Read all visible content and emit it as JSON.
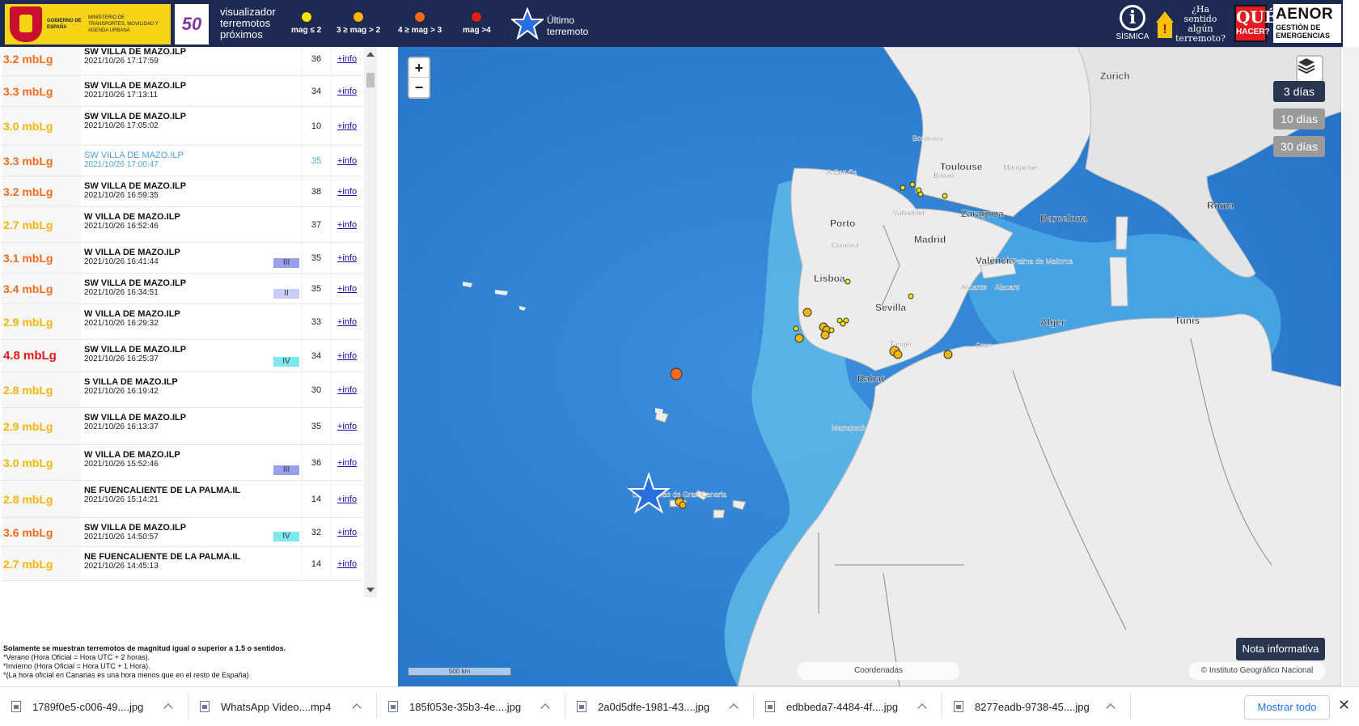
{
  "header": {
    "gov_line1": "GOBIERNO DE ESPAÑA",
    "gov_line2": "MINISTERIO DE TRANSPORTES, MOVILIDAD Y AGENDA URBANA",
    "logo50_number": "50",
    "app_title": "visualizador terremotos próximos",
    "legend": [
      {
        "label": "mag ≤ 2",
        "color": "#f5e10c"
      },
      {
        "label": "3 ≥ mag > 2",
        "color": "#f5b50c"
      },
      {
        "label": "4 ≥ mag > 3",
        "color": "#f26b1d"
      },
      {
        "label": "mag >4",
        "color": "#d91e1e"
      }
    ],
    "last_quake_label": "Último terremoto",
    "sismica_label": "SÍSMICA",
    "sentido_label": "¿Ha sentido algún terremoto?",
    "quehacer_q": "QUÉ",
    "quehacer_h": "HACER?",
    "aenor_name": "AENOR",
    "aenor_sub": "GESTIÓN DE EMERGENCIAS"
  },
  "earthquakes": [
    {
      "mag": "3.2 mbLg",
      "color": "#f26b1d",
      "loc": "SW VILLA DE MAZO.ILP",
      "date": "2021/10/26 17:17:59",
      "depth": "36",
      "intensity": "",
      "info": "+info",
      "highlight": false
    },
    {
      "mag": "3.3 mbLg",
      "color": "#f26b1d",
      "loc": "SW VILLA DE MAZO.ILP",
      "date": "2021/10/26 17:13:11",
      "depth": "34",
      "intensity": "",
      "info": "+info",
      "highlight": false
    },
    {
      "mag": "3.0 mbLg",
      "color": "#f5b50c",
      "loc": "SW VILLA DE MAZO.ILP",
      "date": "2021/10/26 17:05:02",
      "depth": "10",
      "intensity": "",
      "info": "+info",
      "highlight": false
    },
    {
      "mag": "3.3 mbLg",
      "color": "#f26b1d",
      "loc": "SW VILLA DE MAZO.ILP",
      "date": "2021/10/26 17:00:47",
      "depth": "35",
      "intensity": "",
      "info": "+info",
      "highlight": true
    },
    {
      "mag": "3.2 mbLg",
      "color": "#f26b1d",
      "loc": "SW VILLA DE MAZO.ILP",
      "date": "2021/10/26 16:59:35",
      "depth": "38",
      "intensity": "",
      "info": "+info",
      "highlight": false
    },
    {
      "mag": "2.7 mbLg",
      "color": "#f5b50c",
      "loc": "W VILLA DE MAZO.ILP",
      "date": "2021/10/26 16:52:46",
      "depth": "37",
      "intensity": "",
      "info": "+info",
      "highlight": false
    },
    {
      "mag": "3.1 mbLg",
      "color": "#f26b1d",
      "loc": "W VILLA DE MAZO.ILP",
      "date": "2021/10/26 16:41:44",
      "depth": "35",
      "intensity": "III",
      "int_color": "#9aa0f0",
      "info": "+info",
      "highlight": false
    },
    {
      "mag": "3.4 mbLg",
      "color": "#f26b1d",
      "loc": "SW VILLA DE MAZO.ILP",
      "date": "2021/10/26 16:34:51",
      "depth": "35",
      "intensity": "II",
      "int_color": "#c8cdf5",
      "info": "+info",
      "highlight": false
    },
    {
      "mag": "2.9 mbLg",
      "color": "#f5b50c",
      "loc": "W VILLA DE MAZO.ILP",
      "date": "2021/10/26 16:29:32",
      "depth": "33",
      "intensity": "",
      "info": "+info",
      "highlight": false
    },
    {
      "mag": "4.8 mbLg",
      "color": "#e01818",
      "loc": "SW VILLA DE MAZO.ILP",
      "date": "2021/10/26 16:25:37",
      "depth": "34",
      "intensity": "IV",
      "int_color": "#7ee8ee",
      "info": "+info",
      "highlight": false
    },
    {
      "mag": "2.8 mbLg",
      "color": "#f5b50c",
      "loc": "S VILLA DE MAZO.ILP",
      "date": "2021/10/26 16:19:42",
      "depth": "30",
      "intensity": "",
      "info": "+info",
      "highlight": false
    },
    {
      "mag": "2.9 mbLg",
      "color": "#f5b50c",
      "loc": "SW VILLA DE MAZO.ILP",
      "date": "2021/10/26 16:13:37",
      "depth": "35",
      "intensity": "",
      "info": "+info",
      "highlight": false
    },
    {
      "mag": "3.0 mbLg",
      "color": "#f5b50c",
      "loc": "W VILLA DE MAZO.ILP",
      "date": "2021/10/26 15:52:46",
      "depth": "36",
      "intensity": "III",
      "int_color": "#9aa0f0",
      "info": "+info",
      "highlight": false
    },
    {
      "mag": "2.8 mbLg",
      "color": "#f5b50c",
      "loc": "NE FUENCALIENTE DE LA PALMA.IL",
      "date": "2021/10/26 15:14:21",
      "depth": "14",
      "intensity": "",
      "info": "+info",
      "highlight": false
    },
    {
      "mag": "3.6 mbLg",
      "color": "#f26b1d",
      "loc": "SW VILLA DE MAZO.ILP",
      "date": "2021/10/26 14:50:57",
      "depth": "32",
      "intensity": "IV",
      "int_color": "#7ee8ee",
      "info": "+info",
      "highlight": false
    },
    {
      "mag": "2.7 mbLg",
      "color": "#f5b50c",
      "loc": "NE FUENCALIENTE DE LA PALMA.IL",
      "date": "2021/10/26 14:45:13",
      "depth": "14",
      "intensity": "",
      "info": "+info",
      "highlight": false
    }
  ],
  "notes": {
    "line1": "Solamente se muestran terremotos de magnitud igual o superior a 1.5 o sentidos.",
    "line2": "*Verano (Hora Oficial = Hora UTC + 2 horas).",
    "line3": "*Invierno (Hora Oficial = Hora UTC + 1 Hora).",
    "line4": "*(La hora oficial en Canarias es una hora menos que en el resto de España)"
  },
  "map": {
    "zoom_in": "+",
    "zoom_out": "−",
    "ranges": [
      "3 días",
      "10 días",
      "30 días"
    ],
    "active_range": "3 días",
    "nota": "Nota informativa",
    "coords_label": "Coordenadas",
    "attribution": "© Instituto Geográfico Nacional",
    "scale_label": "500 km",
    "labels": [
      {
        "name": "Zurich",
        "bold": true
      },
      {
        "name": "Bordeaux",
        "bold": false
      },
      {
        "name": "Toulouse",
        "bold": true
      },
      {
        "name": "Montpellier",
        "bold": false
      },
      {
        "name": "A Coruña",
        "bold": false
      },
      {
        "name": "Bilbao",
        "bold": false
      },
      {
        "name": "Valladolid",
        "bold": false
      },
      {
        "name": "Zaragoza",
        "bold": true
      },
      {
        "name": "Barcelona",
        "bold": true
      },
      {
        "name": "Porto",
        "bold": true
      },
      {
        "name": "Coimbra",
        "bold": false
      },
      {
        "name": "Madrid",
        "bold": true
      },
      {
        "name": "València",
        "bold": true
      },
      {
        "name": "Palma de Mallorca",
        "bold": false
      },
      {
        "name": "Lisboa",
        "bold": true
      },
      {
        "name": "Alicante",
        "bold": false
      },
      {
        "name": "Alacant",
        "bold": false
      },
      {
        "name": "Sevilla",
        "bold": true
      },
      {
        "name": "Roma",
        "bold": true
      },
      {
        "name": "Alger",
        "bold": true
      },
      {
        "name": "Tunis",
        "bold": true
      },
      {
        "name": "Tanger",
        "bold": false
      },
      {
        "name": "Oran",
        "bold": false
      },
      {
        "name": "Rabat",
        "bold": true
      },
      {
        "name": "Marrakech",
        "bold": false
      },
      {
        "name": "Las Palmas de Gran Canaria",
        "bold": false
      }
    ]
  },
  "downloads": [
    {
      "name": "1789f0e5-c006-49....jpg"
    },
    {
      "name": "WhatsApp Video....mp4"
    },
    {
      "name": "185f053e-35b3-4e....jpg"
    },
    {
      "name": "2a0d5dfe-1981-43....jpg"
    },
    {
      "name": "edbbeda7-4484-4f....jpg"
    },
    {
      "name": "8277eadb-9738-45....jpg"
    }
  ],
  "show_all": "Mostrar todo"
}
